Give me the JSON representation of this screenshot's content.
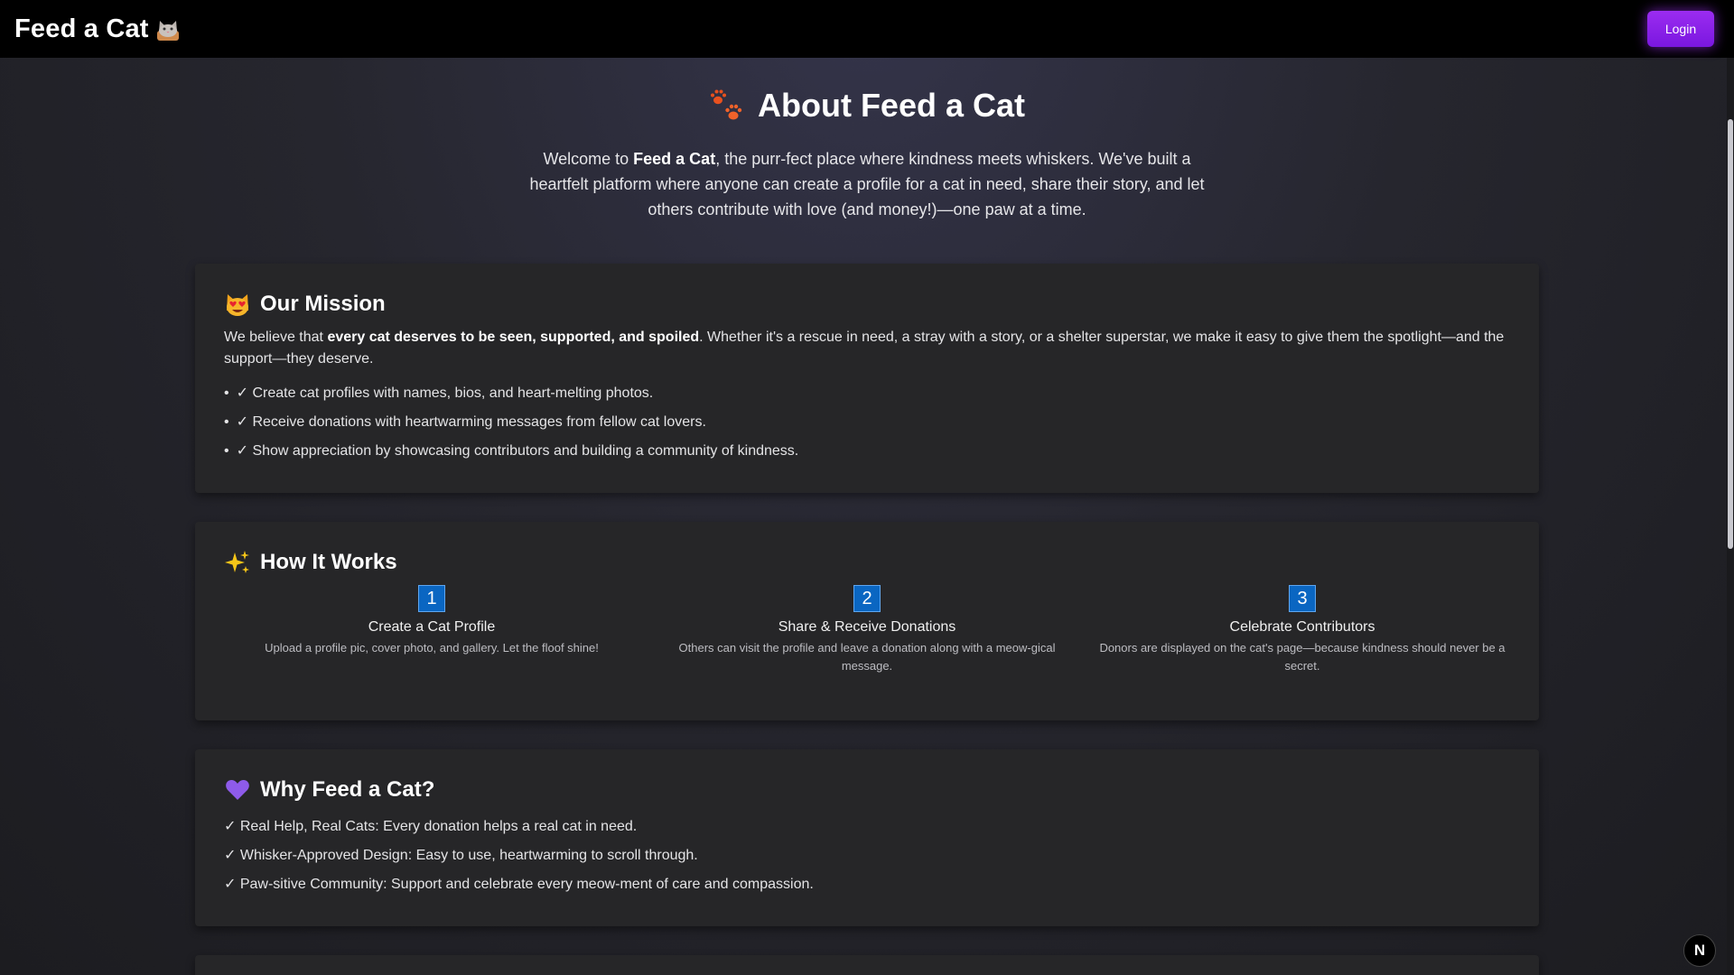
{
  "navbar": {
    "brand_title": "Feed a Cat",
    "brand_icon": "cat-face-icon",
    "login_label": "Login",
    "accent_color": "#8a1fe8"
  },
  "hero": {
    "icon": "paw-prints-icon",
    "title": "About Feed a Cat",
    "intro_before": "Welcome to ",
    "intro_bold": "Feed a Cat",
    "intro_after": ", the purr-fect place where kindness meets whiskers. We've built a heartfelt platform where anyone can create a profile for a cat in need, share their story, and let others contribute with love (and money!)—one paw at a time."
  },
  "mission": {
    "icon": "heart-eyes-cat-icon",
    "title": "Our Mission",
    "text_before": "We believe that ",
    "text_bold": "every cat deserves to be seen, supported, and spoiled",
    "text_after": ". Whether it's a rescue in need, a stray with a story, or a shelter superstar, we make it easy to give them the spotlight—and the support—they deserve.",
    "items": [
      "✓ Create cat profiles with names, bios, and heart-melting photos.",
      "✓ Receive donations with heartwarming messages from fellow cat lovers.",
      "✓ Show appreciation by showcasing contributors and building a community of kindness."
    ]
  },
  "how": {
    "icon": "sparkles-icon",
    "title": "How It Works",
    "steps": [
      {
        "num": "1",
        "title": "Create a Cat Profile",
        "desc": "Upload a profile pic, cover photo, and gallery. Let the floof shine!"
      },
      {
        "num": "2",
        "title": "Share & Receive Donations",
        "desc": "Others can visit the profile and leave a donation along with a meow-gical message."
      },
      {
        "num": "3",
        "title": "Celebrate Contributors",
        "desc": "Donors are displayed on the cat's page—because kindness should never be a secret."
      }
    ],
    "step_color": "#0a66c2"
  },
  "why": {
    "icon": "purple-heart-icon",
    "title": "Why Feed a Cat?",
    "items": [
      "✓ Real Help, Real Cats: Every donation helps a real cat in need.",
      "✓ Whisker-Approved Design: Easy to use, heartwarming to scroll through.",
      "✓ Paw-sitive Community: Support and celebrate every meow-ment of care and compassion."
    ]
  },
  "dev_badge": {
    "label": "N",
    "icon": "nextjs-icon"
  }
}
